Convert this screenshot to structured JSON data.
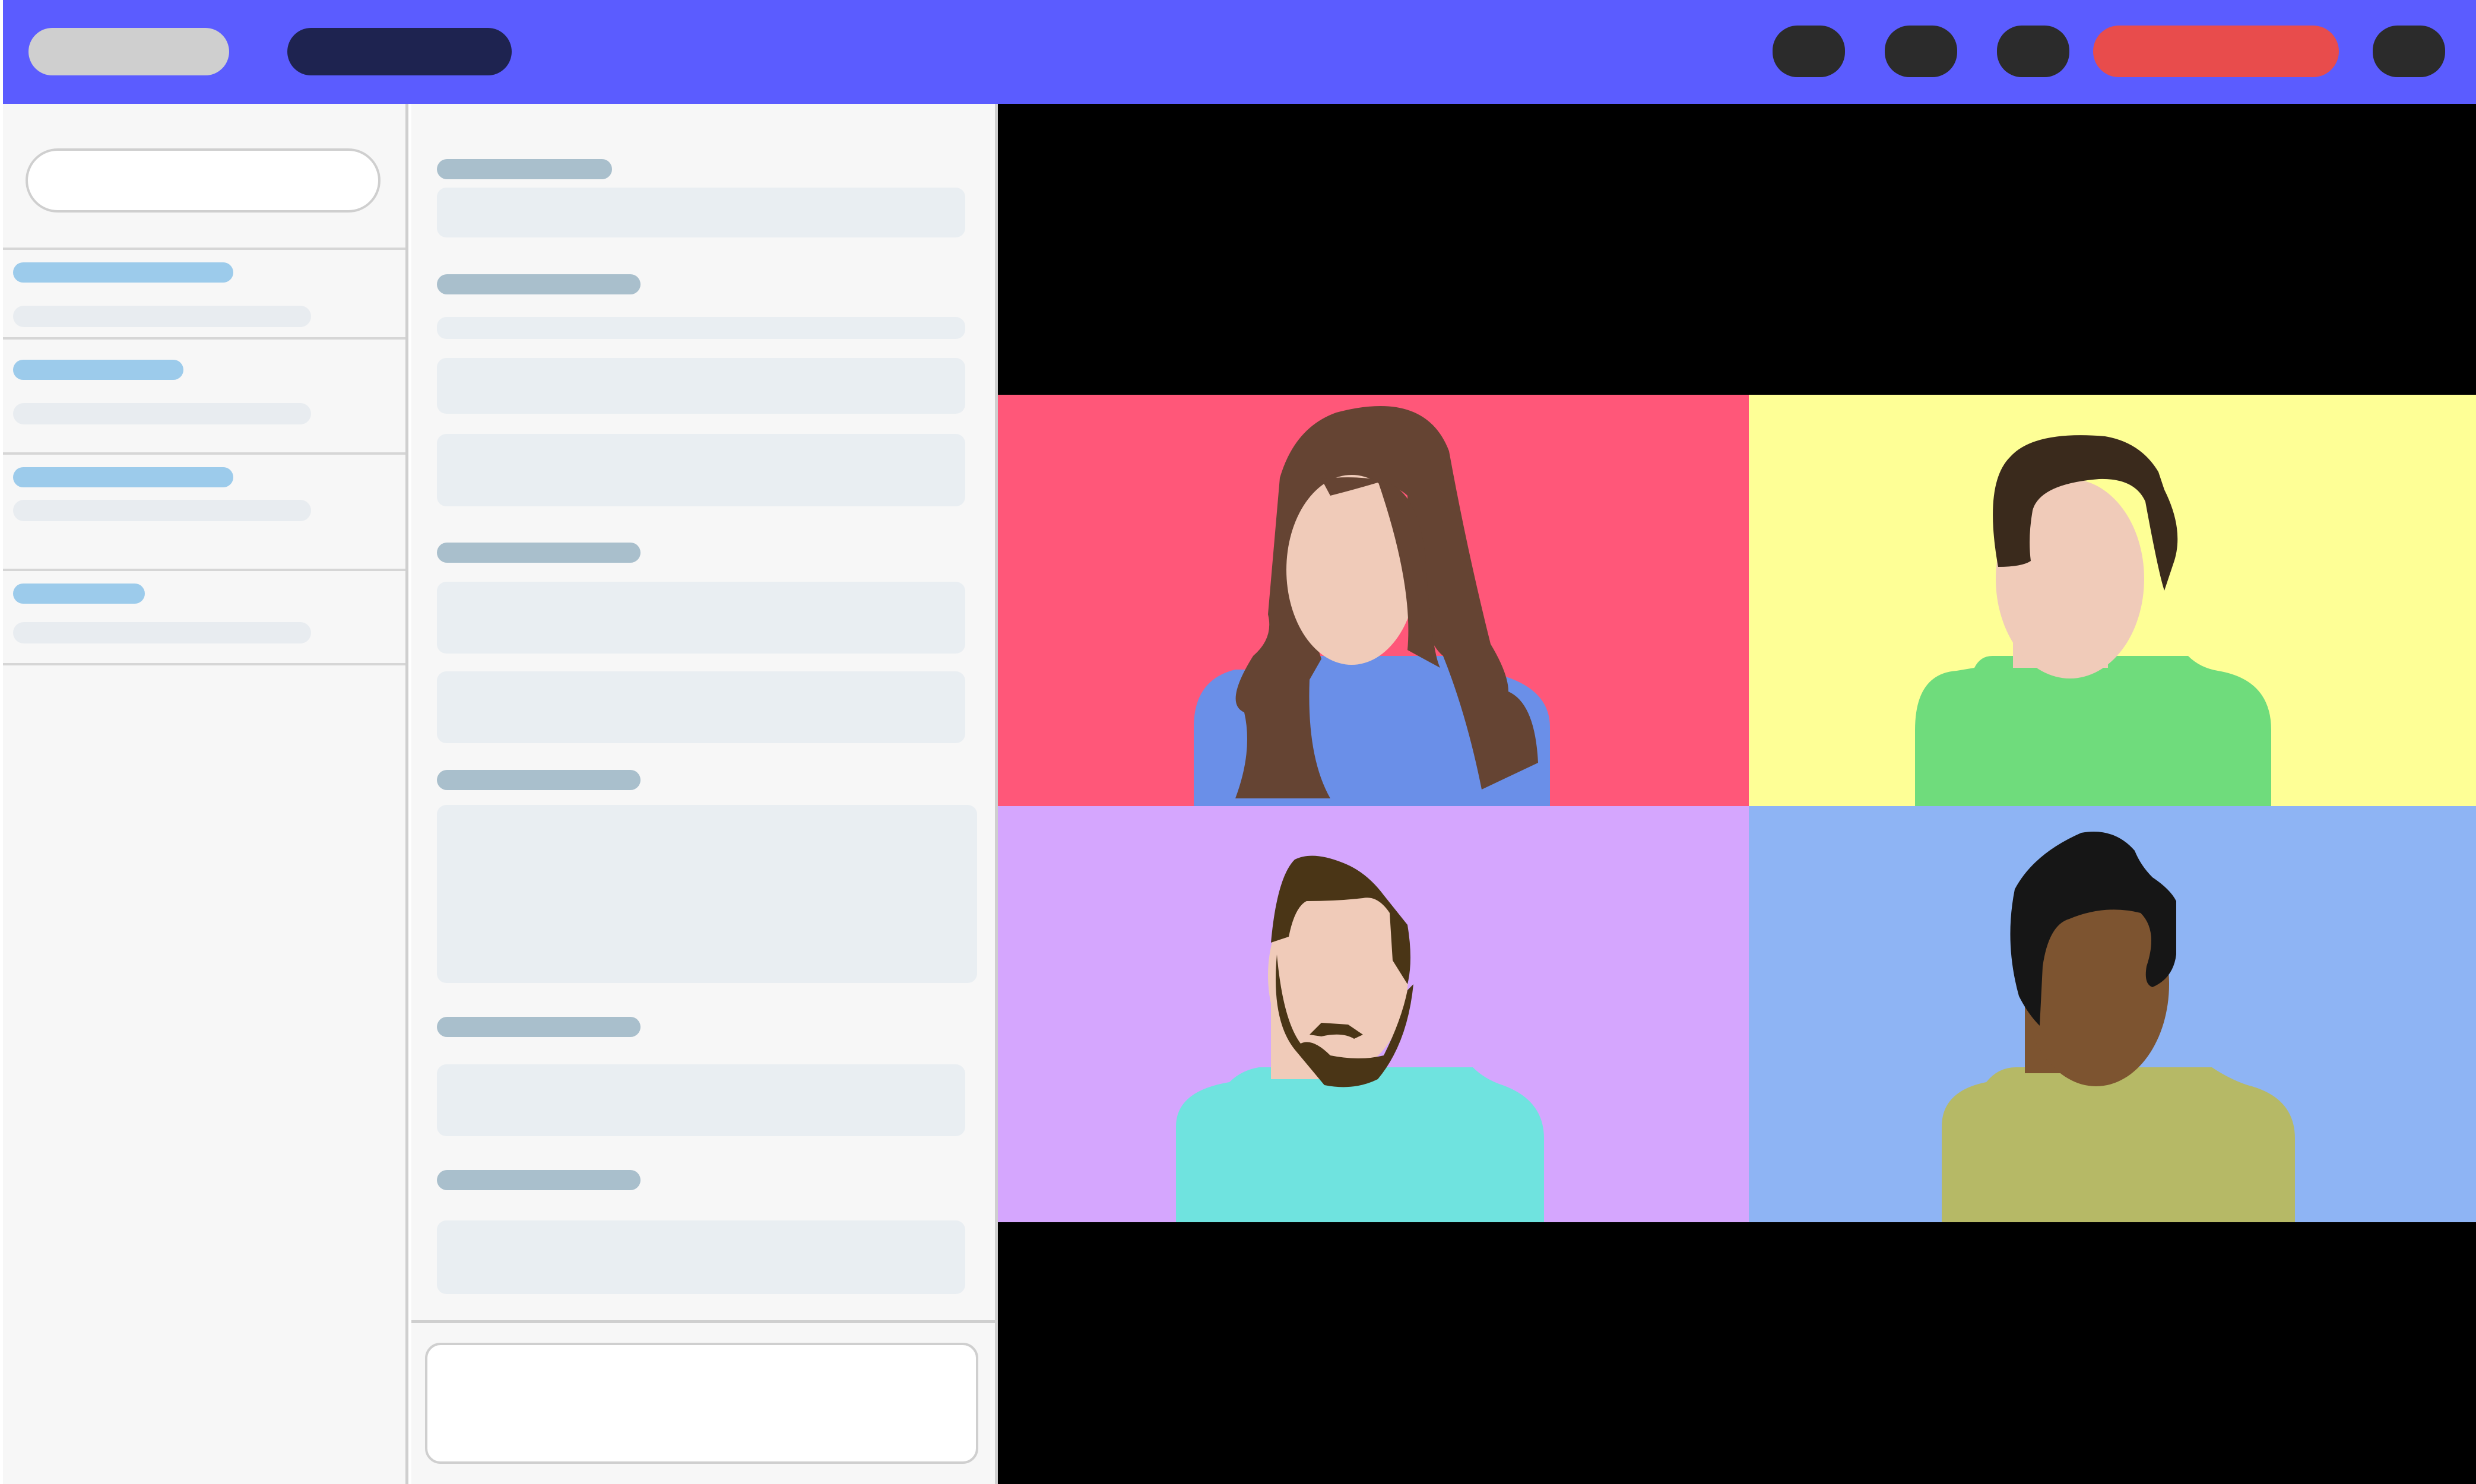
{
  "colors": {
    "top_bar": "#5b5cff",
    "pill_light": "#cfcfcf",
    "pill_dark": "#1e2350",
    "control_button": "#2b2b2b",
    "leave_button": "#e84c4c",
    "sidebar_bg": "#f7f7f7",
    "sidebar_title_placeholder": "#9ccbeb",
    "sidebar_line_placeholder": "#e8ecf0",
    "form_label_placeholder": "#a9bfcc",
    "form_field_placeholder": "#e9eef2",
    "video_bg": "#000000"
  },
  "top_bar": {
    "left_pills": [
      "light-pill",
      "dark-pill"
    ],
    "controls": [
      "control-button-1",
      "control-button-2",
      "control-button-3",
      "leave-call-button",
      "control-button-5"
    ]
  },
  "sidebar": {
    "search_icon": "search-field",
    "item_count_visible": 4
  },
  "video_grid": {
    "layout": "2x2",
    "participants": [
      {
        "slot": "top-left",
        "tile_bg": "#ff5779",
        "shirt": "#6a8fe8",
        "skin": "#f0cbb9",
        "hair": "#654433",
        "avatar_icon": "woman-long-hair-avatar-icon"
      },
      {
        "slot": "top-right",
        "tile_bg": "#feff96",
        "shirt": "#6fdc7c",
        "skin": "#f0cbb9",
        "hair": "#3a2a1c",
        "avatar_icon": "man-short-hair-avatar-icon"
      },
      {
        "slot": "bottom-left",
        "tile_bg": "#d5a6fe",
        "shirt": "#6fe3df",
        "skin": "#f0cbb9",
        "hair": "#4a3516",
        "avatar_icon": "man-beard-avatar-icon"
      },
      {
        "slot": "bottom-right",
        "tile_bg": "#8eb4f4",
        "shirt": "#b6b966",
        "skin": "#7d5430",
        "hair": "#161616",
        "avatar_icon": "man-curly-hair-avatar-icon"
      }
    ]
  }
}
